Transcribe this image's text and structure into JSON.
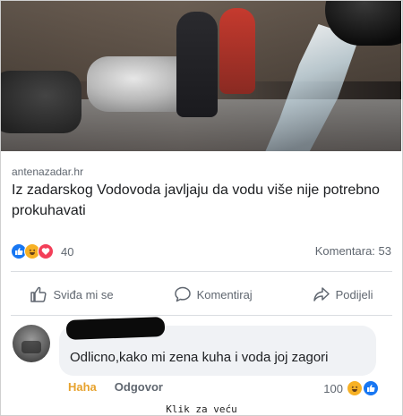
{
  "post": {
    "source": "antenazadar.hr",
    "headline": "Iz zadarskog Vodovoda javljaju da vodu više nije potrebno prokuhavati",
    "reaction_count": "40",
    "comments_count": "Komentara: 53",
    "reaction_icons": [
      "like-icon",
      "haha-icon",
      "love-icon"
    ]
  },
  "actions": {
    "like_label": "Sviđa mi se",
    "comment_label": "Komentiraj",
    "share_label": "Podijeli"
  },
  "comment": {
    "text": "Odlicno,kako mi zena kuha i voda joj zagori",
    "haha_label": "Haha",
    "reply_label": "Odgovor",
    "reaction_count": "100"
  },
  "caption": "Klik za veću",
  "colors": {
    "fb_blue": "#1877f2",
    "haha_yellow": "#f7b125",
    "love_red": "#f33e58",
    "text_dark": "#1c1e21",
    "text_muted": "#606770"
  }
}
